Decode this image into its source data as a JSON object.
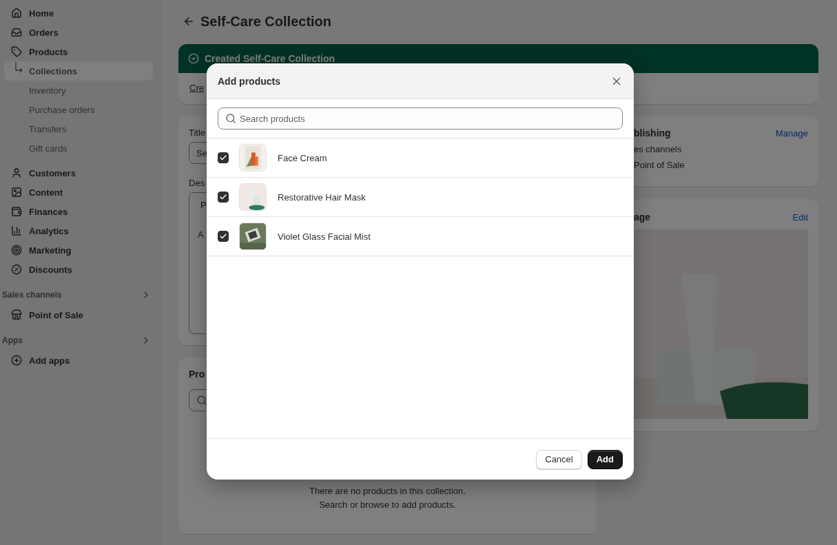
{
  "sidebar": {
    "items": [
      {
        "label": "Home",
        "selected": false
      },
      {
        "label": "Orders",
        "selected": false
      },
      {
        "label": "Products",
        "selected": false,
        "children": [
          {
            "label": "Collections",
            "selected": true
          },
          {
            "label": "Inventory",
            "selected": false
          },
          {
            "label": "Purchase orders",
            "selected": false
          },
          {
            "label": "Transfers",
            "selected": false
          },
          {
            "label": "Gift cards",
            "selected": false
          }
        ]
      },
      {
        "label": "Customers",
        "selected": false
      },
      {
        "label": "Content",
        "selected": false
      },
      {
        "label": "Finances",
        "selected": false
      },
      {
        "label": "Analytics",
        "selected": false
      },
      {
        "label": "Marketing",
        "selected": false
      },
      {
        "label": "Discounts",
        "selected": false
      }
    ],
    "sections": [
      {
        "title": "Sales channels",
        "items": [
          {
            "label": "Point of Sale",
            "selected": false
          }
        ]
      },
      {
        "title": "Apps",
        "items": [
          {
            "label": "Add apps",
            "selected": false
          }
        ]
      }
    ]
  },
  "page": {
    "title": "Self-Care Collection"
  },
  "banner": {
    "message": "Created Self-Care Collection",
    "link": "Cre"
  },
  "details_card": {
    "title_label": "Title",
    "title_value": "Se",
    "description_label": "Des",
    "editor_toolbar": "P",
    "editor_text": "A"
  },
  "products_card": {
    "heading": "Pro",
    "empty_lines": [
      "There are no products in this collection.",
      "Search or browse to add products."
    ]
  },
  "publishing_card": {
    "heading": "blishing",
    "action": "Manage",
    "lines": [
      "es channels",
      "Point of Sale"
    ]
  },
  "image_card": {
    "heading": "age",
    "action": "Edit"
  },
  "modal": {
    "title": "Add products",
    "search": {
      "placeholder": "Search products"
    },
    "products": [
      {
        "name": "Face Cream",
        "checked": true
      },
      {
        "name": "Restorative Hair Mask",
        "checked": true
      },
      {
        "name": "Violet Glass Facial Mist",
        "checked": true
      }
    ],
    "buttons": [
      {
        "label": "Cancel",
        "kind": "secondary"
      },
      {
        "label": "Add",
        "kind": "primary"
      }
    ]
  }
}
